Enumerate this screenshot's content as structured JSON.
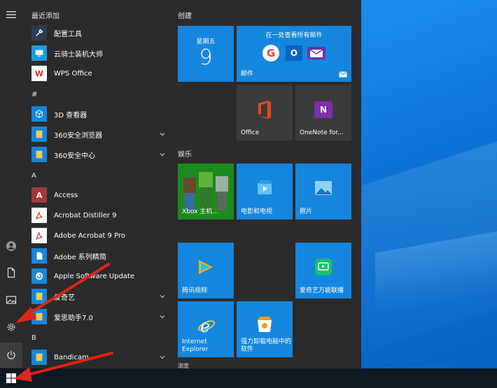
{
  "start_menu": {
    "sections": {
      "recent_header": "最近添加",
      "hash_header": "#",
      "a_header": "A",
      "b_header": "B"
    },
    "apps": {
      "config_tool": "配置工具",
      "yunqishi": "云骑士装机大师",
      "wps": "WPS Office",
      "viewer3d": "3D 查看器",
      "browser360": "360安全浏览器",
      "security360": "360安全中心",
      "access": "Access",
      "distiller": "Acrobat Distiller 9",
      "acrobat": "Adobe Acrobat 9 Pro",
      "adobe_series": "Adobe 系列精简",
      "apple_update": "Apple Software Update",
      "iqiyi": "爱奇艺",
      "aisi": "爱思助手7.0",
      "bandicam": "Bandicam"
    },
    "tiles": {
      "group_create": "创建",
      "group_entertainment": "娱乐",
      "calendar_day": "星期五",
      "calendar_date": "9",
      "mail_top": "在一处查看所有邮件",
      "mail_label": "邮件",
      "office": "Office",
      "onenote": "OneNote for...",
      "xbox": "Xbox 主机...",
      "movies": "电影和电视",
      "photos": "照片",
      "tencent_video": "腾讯视频",
      "iqiyi_screen": "爱奇艺万能联播",
      "ie": "Internet Explorer",
      "uninstall": "强力卸载电脑中的软件",
      "group_more_partial": "浏览"
    }
  },
  "colors": {
    "tile_blue": "#1586de",
    "menu_bg": "#2b2b2b",
    "annotation_arrow": "#e0241b"
  }
}
